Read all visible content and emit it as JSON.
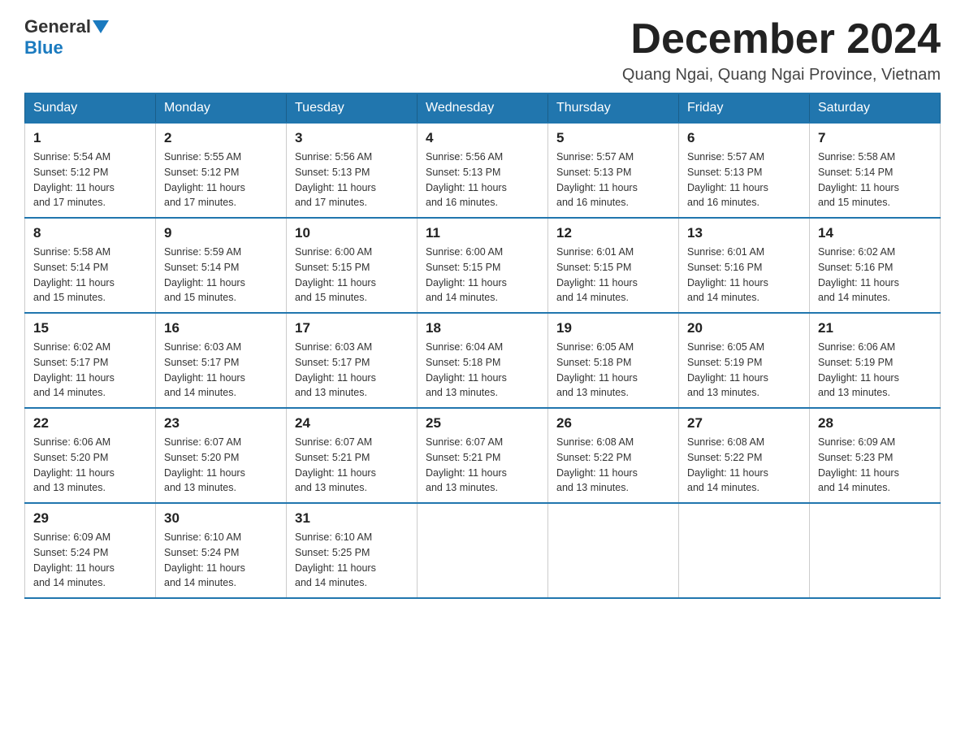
{
  "header": {
    "logo_general": "General",
    "logo_blue": "Blue",
    "month_title": "December 2024",
    "location": "Quang Ngai, Quang Ngai Province, Vietnam"
  },
  "weekdays": [
    "Sunday",
    "Monday",
    "Tuesday",
    "Wednesday",
    "Thursday",
    "Friday",
    "Saturday"
  ],
  "weeks": [
    [
      {
        "day": "1",
        "sunrise": "5:54 AM",
        "sunset": "5:12 PM",
        "daylight": "11 hours and 17 minutes."
      },
      {
        "day": "2",
        "sunrise": "5:55 AM",
        "sunset": "5:12 PM",
        "daylight": "11 hours and 17 minutes."
      },
      {
        "day": "3",
        "sunrise": "5:56 AM",
        "sunset": "5:13 PM",
        "daylight": "11 hours and 17 minutes."
      },
      {
        "day": "4",
        "sunrise": "5:56 AM",
        "sunset": "5:13 PM",
        "daylight": "11 hours and 16 minutes."
      },
      {
        "day": "5",
        "sunrise": "5:57 AM",
        "sunset": "5:13 PM",
        "daylight": "11 hours and 16 minutes."
      },
      {
        "day": "6",
        "sunrise": "5:57 AM",
        "sunset": "5:13 PM",
        "daylight": "11 hours and 16 minutes."
      },
      {
        "day": "7",
        "sunrise": "5:58 AM",
        "sunset": "5:14 PM",
        "daylight": "11 hours and 15 minutes."
      }
    ],
    [
      {
        "day": "8",
        "sunrise": "5:58 AM",
        "sunset": "5:14 PM",
        "daylight": "11 hours and 15 minutes."
      },
      {
        "day": "9",
        "sunrise": "5:59 AM",
        "sunset": "5:14 PM",
        "daylight": "11 hours and 15 minutes."
      },
      {
        "day": "10",
        "sunrise": "6:00 AM",
        "sunset": "5:15 PM",
        "daylight": "11 hours and 15 minutes."
      },
      {
        "day": "11",
        "sunrise": "6:00 AM",
        "sunset": "5:15 PM",
        "daylight": "11 hours and 14 minutes."
      },
      {
        "day": "12",
        "sunrise": "6:01 AM",
        "sunset": "5:15 PM",
        "daylight": "11 hours and 14 minutes."
      },
      {
        "day": "13",
        "sunrise": "6:01 AM",
        "sunset": "5:16 PM",
        "daylight": "11 hours and 14 minutes."
      },
      {
        "day": "14",
        "sunrise": "6:02 AM",
        "sunset": "5:16 PM",
        "daylight": "11 hours and 14 minutes."
      }
    ],
    [
      {
        "day": "15",
        "sunrise": "6:02 AM",
        "sunset": "5:17 PM",
        "daylight": "11 hours and 14 minutes."
      },
      {
        "day": "16",
        "sunrise": "6:03 AM",
        "sunset": "5:17 PM",
        "daylight": "11 hours and 14 minutes."
      },
      {
        "day": "17",
        "sunrise": "6:03 AM",
        "sunset": "5:17 PM",
        "daylight": "11 hours and 13 minutes."
      },
      {
        "day": "18",
        "sunrise": "6:04 AM",
        "sunset": "5:18 PM",
        "daylight": "11 hours and 13 minutes."
      },
      {
        "day": "19",
        "sunrise": "6:05 AM",
        "sunset": "5:18 PM",
        "daylight": "11 hours and 13 minutes."
      },
      {
        "day": "20",
        "sunrise": "6:05 AM",
        "sunset": "5:19 PM",
        "daylight": "11 hours and 13 minutes."
      },
      {
        "day": "21",
        "sunrise": "6:06 AM",
        "sunset": "5:19 PM",
        "daylight": "11 hours and 13 minutes."
      }
    ],
    [
      {
        "day": "22",
        "sunrise": "6:06 AM",
        "sunset": "5:20 PM",
        "daylight": "11 hours and 13 minutes."
      },
      {
        "day": "23",
        "sunrise": "6:07 AM",
        "sunset": "5:20 PM",
        "daylight": "11 hours and 13 minutes."
      },
      {
        "day": "24",
        "sunrise": "6:07 AM",
        "sunset": "5:21 PM",
        "daylight": "11 hours and 13 minutes."
      },
      {
        "day": "25",
        "sunrise": "6:07 AM",
        "sunset": "5:21 PM",
        "daylight": "11 hours and 13 minutes."
      },
      {
        "day": "26",
        "sunrise": "6:08 AM",
        "sunset": "5:22 PM",
        "daylight": "11 hours and 13 minutes."
      },
      {
        "day": "27",
        "sunrise": "6:08 AM",
        "sunset": "5:22 PM",
        "daylight": "11 hours and 14 minutes."
      },
      {
        "day": "28",
        "sunrise": "6:09 AM",
        "sunset": "5:23 PM",
        "daylight": "11 hours and 14 minutes."
      }
    ],
    [
      {
        "day": "29",
        "sunrise": "6:09 AM",
        "sunset": "5:24 PM",
        "daylight": "11 hours and 14 minutes."
      },
      {
        "day": "30",
        "sunrise": "6:10 AM",
        "sunset": "5:24 PM",
        "daylight": "11 hours and 14 minutes."
      },
      {
        "day": "31",
        "sunrise": "6:10 AM",
        "sunset": "5:25 PM",
        "daylight": "11 hours and 14 minutes."
      },
      null,
      null,
      null,
      null
    ]
  ]
}
